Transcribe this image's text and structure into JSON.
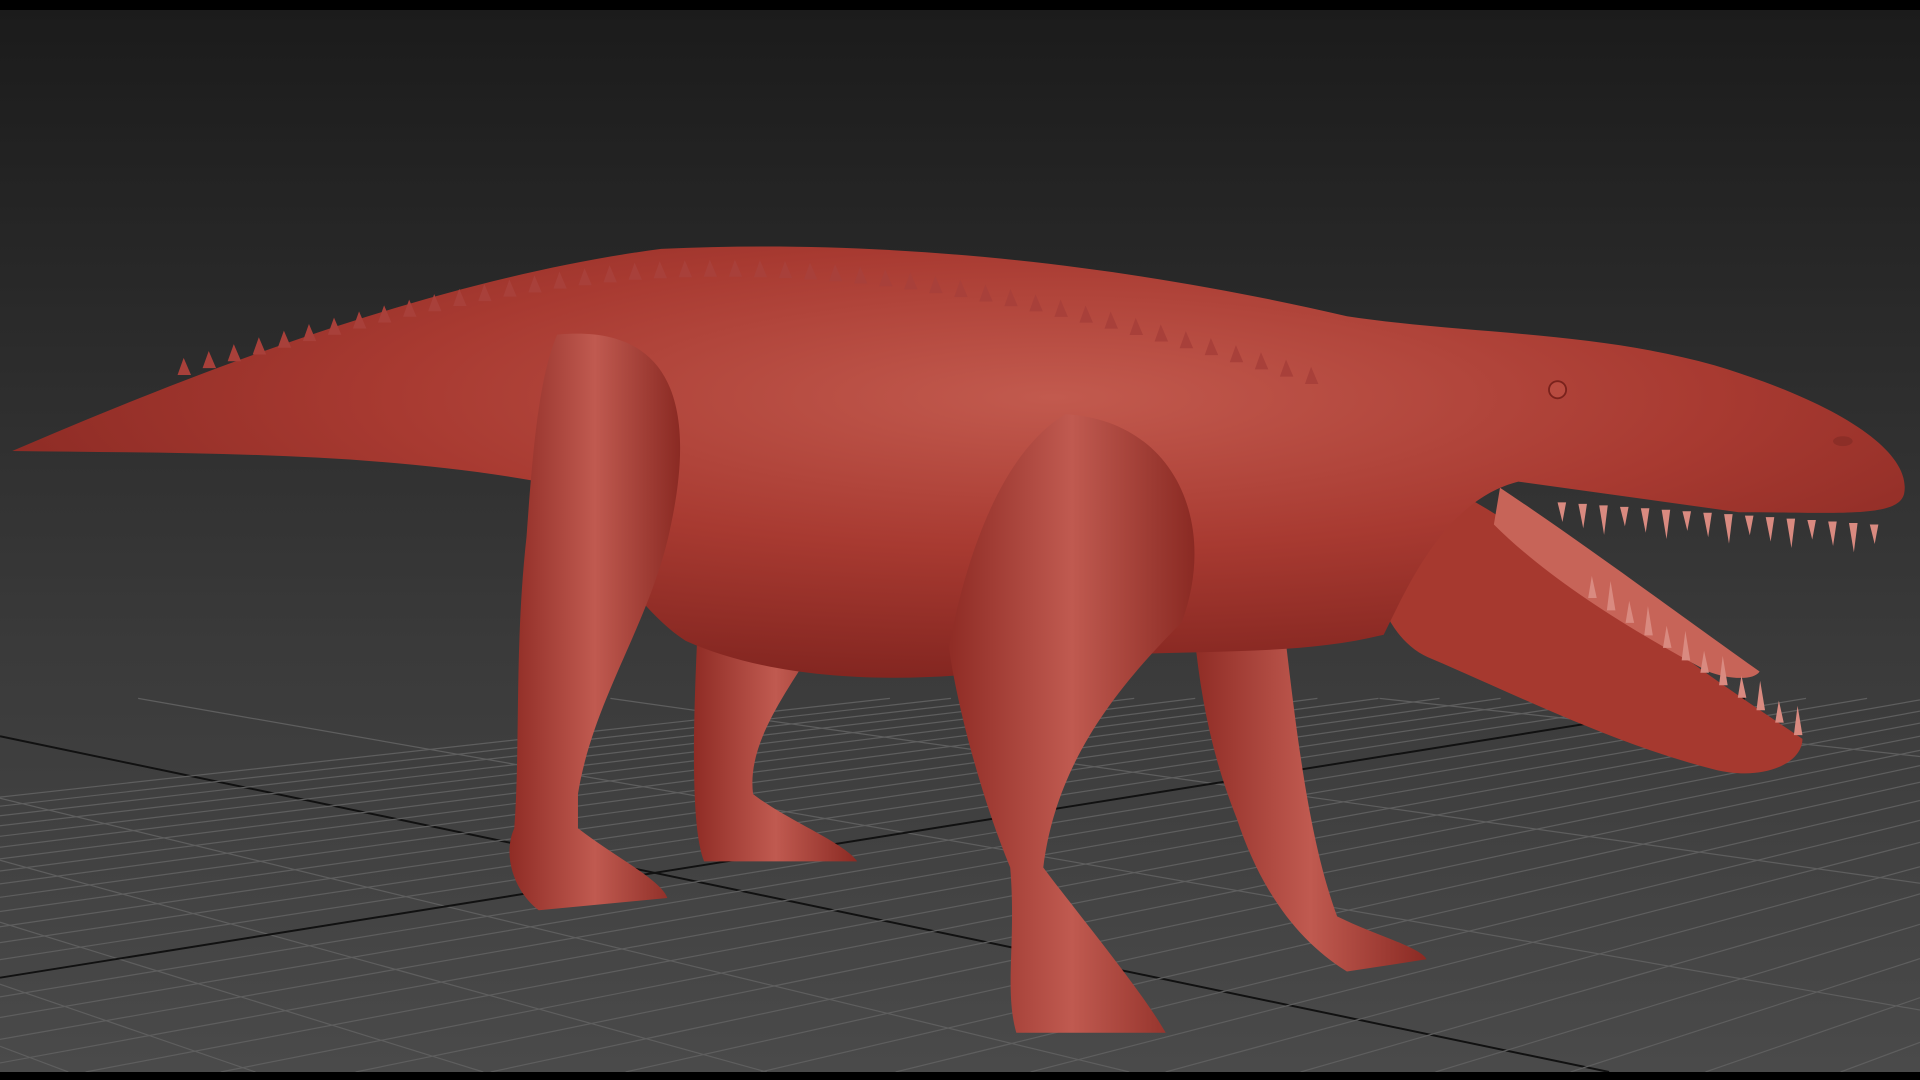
{
  "viewport": {
    "colors": {
      "bg_top": "#1b1b1b",
      "bg_bottom": "#4a4a4a",
      "grid": "#5e5e5e",
      "axis": "#111111",
      "model_light": "#c25a4e",
      "model_mid": "#a83a31",
      "model_dark": "#7e231e"
    },
    "model_icon": "creature-sculpt"
  }
}
